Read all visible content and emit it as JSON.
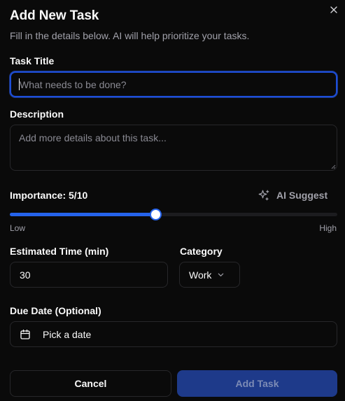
{
  "dialog": {
    "title": "Add New Task",
    "subtitle": "Fill in the details below. AI will help prioritize your tasks."
  },
  "fields": {
    "task_title": {
      "label": "Task Title",
      "value": "",
      "placeholder": "What needs to be done?"
    },
    "description": {
      "label": "Description",
      "value": "",
      "placeholder": "Add more details about this task..."
    },
    "importance": {
      "label": "Importance: 5/10",
      "value": 5,
      "min": 1,
      "max": 10,
      "low_label": "Low",
      "high_label": "High",
      "ai_suggest_label": "AI Suggest"
    },
    "estimated_time": {
      "label": "Estimated Time (min)",
      "value": "30"
    },
    "category": {
      "label": "Category",
      "value": "Work"
    },
    "due_date": {
      "label": "Due Date (Optional)",
      "button_label": "Pick a date"
    }
  },
  "actions": {
    "cancel_label": "Cancel",
    "submit_label": "Add Task"
  },
  "icons": {
    "close": "close-icon",
    "ai_suggest": "sparkles-icon",
    "category_dropdown": "chevron-down-icon",
    "due_date": "calendar-icon"
  },
  "colors": {
    "background": "#0a0a0a",
    "border": "#27272a",
    "accent": "#2563eb",
    "focus_ring": "#1d4ed8",
    "primary_button": "#1e3a8a",
    "muted_text": "#a1a1aa"
  }
}
